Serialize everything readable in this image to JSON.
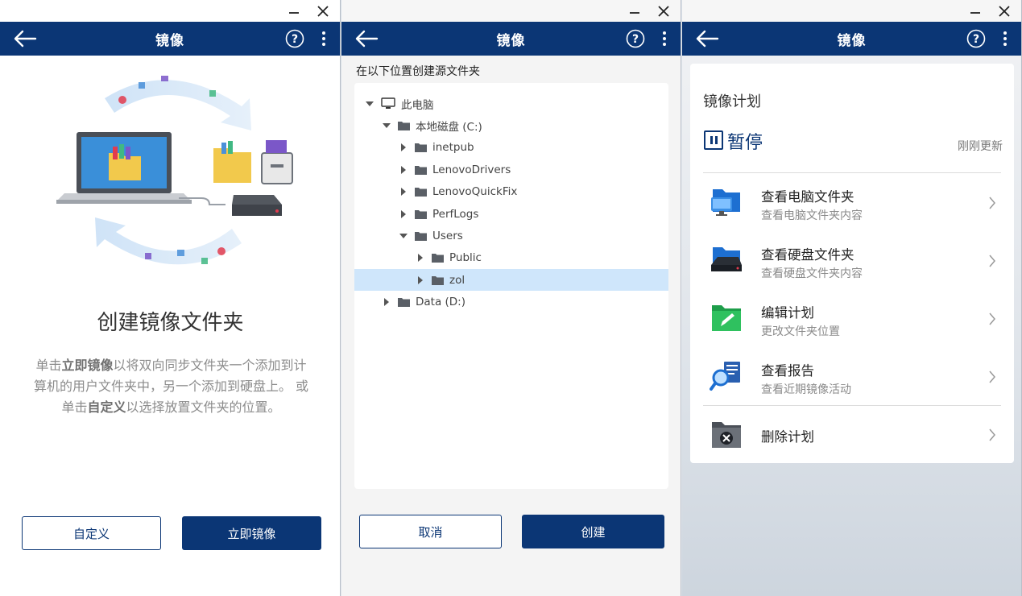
{
  "header_title": "镜像",
  "window1": {
    "heading": "创建镜像文件夹",
    "desc_parts": [
      "单击",
      "立即镜像",
      "以将双向同步文件夹一个添加到计算机的用户文件夹中，另一个添加到硬盘上。 或单击",
      "自定义",
      "以选择放置文件夹的位置。"
    ],
    "btn_custom": "自定义",
    "btn_mirror_now": "立即镜像"
  },
  "window2": {
    "label": "在以下位置创建源文件夹",
    "tree": [
      {
        "label": "此电脑",
        "type": "pc",
        "level": 0,
        "expanded": true
      },
      {
        "label": "本地磁盘 (C:)",
        "type": "folder",
        "level": 1,
        "expanded": true
      },
      {
        "label": "inetpub",
        "type": "folder",
        "level": 2,
        "expanded": false
      },
      {
        "label": "LenovoDrivers",
        "type": "folder",
        "level": 2,
        "expanded": false
      },
      {
        "label": "LenovoQuickFix",
        "type": "folder",
        "level": 2,
        "expanded": false
      },
      {
        "label": "PerfLogs",
        "type": "folder",
        "level": 2,
        "expanded": false
      },
      {
        "label": "Users",
        "type": "folder",
        "level": 2,
        "expanded": true
      },
      {
        "label": "Public",
        "type": "folder",
        "level": 3,
        "expanded": false
      },
      {
        "label": "zol",
        "type": "folder",
        "level": 3,
        "expanded": false,
        "selected": true
      },
      {
        "label": "Data (D:)",
        "type": "folder",
        "level": 1,
        "expanded": false
      }
    ],
    "btn_cancel": "取消",
    "btn_create": "创建"
  },
  "window3": {
    "plan_title": "镜像计划",
    "status": "暂停",
    "updated": "刚刚更新",
    "items": [
      {
        "title": "查看电脑文件夹",
        "sub": "查看电脑文件夹内容",
        "icon": "pc-folder-icon"
      },
      {
        "title": "查看硬盘文件夹",
        "sub": "查看硬盘文件夹内容",
        "icon": "drive-folder-icon"
      },
      {
        "title": "编辑计划",
        "sub": "更改文件夹位置",
        "icon": "edit-plan-icon"
      },
      {
        "title": "查看报告",
        "sub": "查看近期镜像活动",
        "icon": "report-icon"
      }
    ],
    "delete_label": "删除计划"
  },
  "colors": {
    "brand": "#0b3675",
    "selection": "#cfe6fb"
  }
}
